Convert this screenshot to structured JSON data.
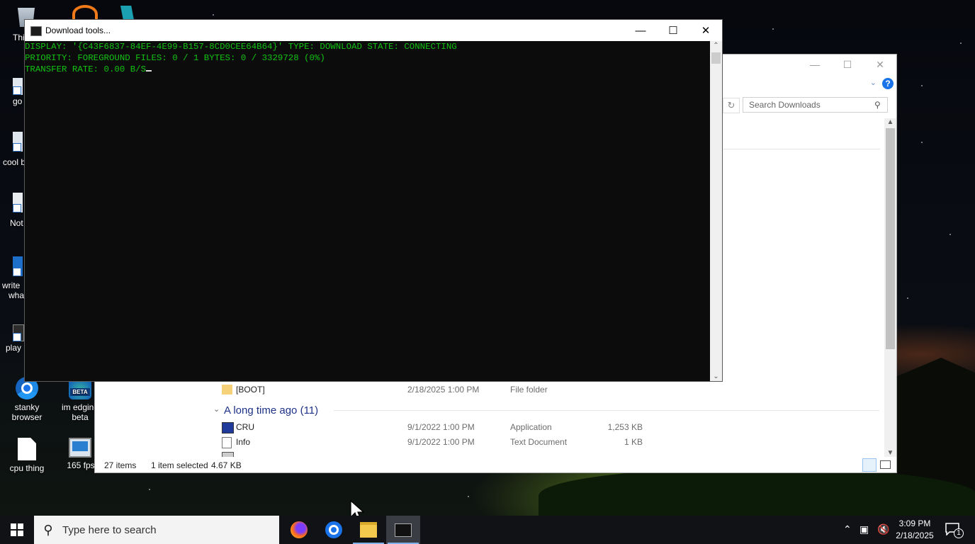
{
  "desktop": {
    "icons": [
      {
        "label": "Thi",
        "name": "this-pc"
      },
      {
        "label": "go",
        "name": "go"
      },
      {
        "label": "cool b",
        "name": "cool-b"
      },
      {
        "label": "Not",
        "name": "not"
      },
      {
        "label": "write",
        "name": "write"
      },
      {
        "label": "wha",
        "name": "wha"
      },
      {
        "label": "play",
        "name": "play"
      },
      {
        "label": "stanky browser",
        "line1": "stanky",
        "line2": "browser"
      },
      {
        "label": "im edging beta",
        "line1": "im edging",
        "line2": "beta"
      },
      {
        "label": "cpu thing"
      },
      {
        "label": "165 fps"
      }
    ],
    "beta_badge": "BETA"
  },
  "console": {
    "title": "Download tools...",
    "lines": [
      "DISPLAY: '{C43F6837-84EF-4E99-B157-8CD0CEE64B64}' TYPE: DOWNLOAD STATE: CONNECTING",
      "PRIORITY: FOREGROUND FILES: 0 / 1 BYTES: 0 / 3329728 (0%)",
      "TRANSFER RATE: 0.00 B/S"
    ],
    "text_color": "#12c312"
  },
  "explorer": {
    "search_placeholder": "Search Downloads",
    "help": "?",
    "rows_before": [
      {
        "name": "[BOOT]",
        "date": "2/18/2025 1:00 PM",
        "type": "File folder",
        "size": ""
      }
    ],
    "group_label": "A long time ago (11)",
    "rows": [
      {
        "name": "CRU",
        "date": "9/1/2022 1:00 PM",
        "type": "Application",
        "size": "1,253 KB"
      },
      {
        "name": "Info",
        "date": "9/1/2022 1:00 PM",
        "type": "Text Document",
        "size": "1 KB"
      }
    ],
    "status": {
      "count": "27 items",
      "selected": "1 item selected",
      "size": "4.67 KB"
    }
  },
  "taskbar": {
    "search_placeholder": "Type here to search",
    "time": "3:09 PM",
    "date": "2/18/2025",
    "notification_count": "1",
    "apps": [
      "firefox",
      "chrome",
      "file-explorer",
      "command-prompt"
    ]
  }
}
